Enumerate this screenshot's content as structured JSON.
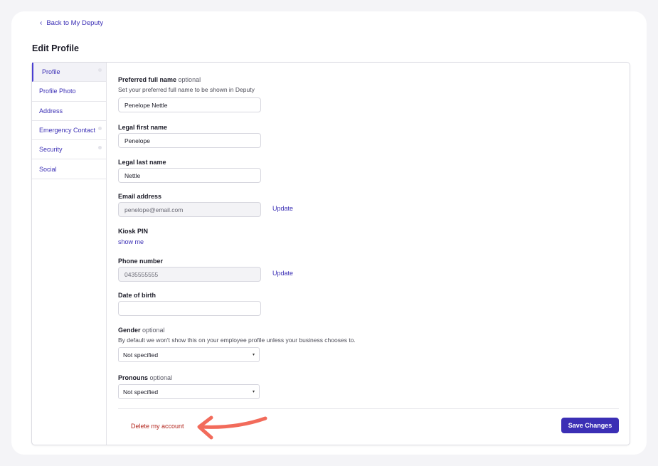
{
  "nav": {
    "back_label": "Back to My Deputy"
  },
  "page": {
    "title": "Edit Profile"
  },
  "sidebar": {
    "items": [
      {
        "label": "Profile",
        "active": true
      },
      {
        "label": "Profile Photo"
      },
      {
        "label": "Address"
      },
      {
        "label": "Emergency Contact"
      },
      {
        "label": "Security"
      },
      {
        "label": "Social"
      }
    ]
  },
  "form": {
    "preferred_name": {
      "label": "Preferred full name",
      "optional": "optional",
      "help": "Set your preferred full name to be shown in Deputy",
      "value": "Penelope Nettle"
    },
    "legal_first": {
      "label": "Legal first name",
      "value": "Penelope"
    },
    "legal_last": {
      "label": "Legal last name",
      "value": "Nettle"
    },
    "email": {
      "label": "Email address",
      "value": "penelope@email.com",
      "action": "Update"
    },
    "kiosk_pin": {
      "label": "Kiosk PIN",
      "action": "show me"
    },
    "phone": {
      "label": "Phone number",
      "value": "0435555555",
      "action": "Update"
    },
    "dob": {
      "label": "Date of birth",
      "value": ""
    },
    "gender": {
      "label": "Gender",
      "optional": "optional",
      "help": "By default we won't show this on your employee profile unless your business chooses to.",
      "value": "Not specified"
    },
    "pronouns": {
      "label": "Pronouns",
      "optional": "optional",
      "value": "Not specified"
    }
  },
  "footer": {
    "delete_label": "Delete my account",
    "save_label": "Save Changes"
  },
  "colors": {
    "accent": "#3b2fb5",
    "danger": "#b3261e",
    "annotation_arrow": "#f26b5b"
  }
}
